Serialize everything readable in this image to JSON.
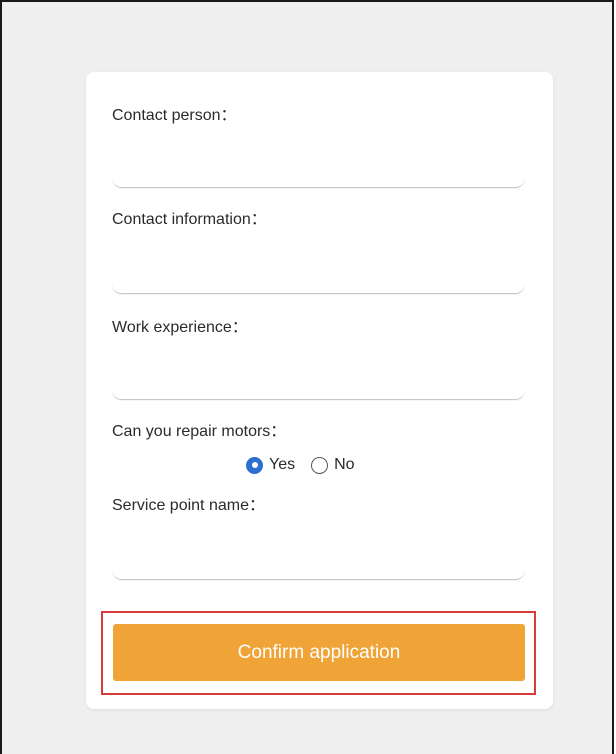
{
  "form": {
    "contact_person_label": "Contact person：",
    "contact_person_value": "",
    "contact_info_label": "Contact information：",
    "contact_info_value": "",
    "work_experience_label": "Work experience：",
    "work_experience_value": "",
    "repair_motors_label": "Can you repair motors：",
    "repair_options": [
      {
        "label": "Yes",
        "selected": true
      },
      {
        "label": "No",
        "selected": false
      }
    ],
    "service_point_label": "Service point name：",
    "service_point_value": "",
    "confirm_button": "Confirm application"
  },
  "colors": {
    "page_background": "#efefef",
    "card_background": "#ffffff",
    "button_accent": "#f0a336",
    "radio_selected": "#2d6fd0",
    "highlight_border": "#d93a3a"
  },
  "icons": {
    "radio_selected": "radio-checked-icon",
    "radio_unselected": "radio-unchecked-icon"
  }
}
